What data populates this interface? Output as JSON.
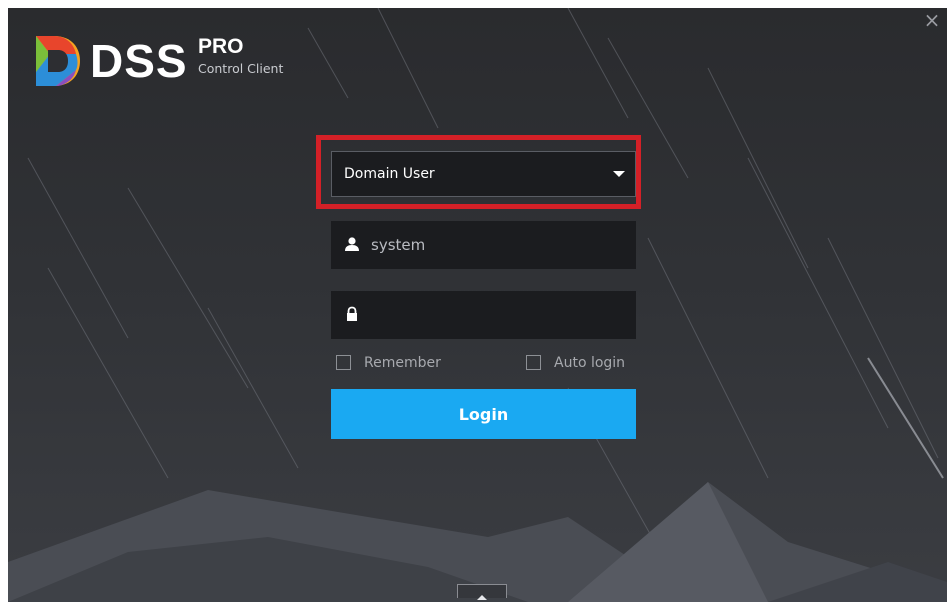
{
  "brand": {
    "name": "DSS",
    "edition": "PRO",
    "product": "Control Client"
  },
  "window": {
    "close_glyph": "×"
  },
  "login_form": {
    "user_type": "Domain User",
    "username_value": "system",
    "password_value": "",
    "remember_label": "Remember",
    "auto_login_label": "Auto login",
    "login_button_label": "Login"
  },
  "icons": {
    "user": "user-icon",
    "lock": "lock-icon",
    "dropdown": "caret-down-icon",
    "expand": "chevron-up-icon"
  },
  "colors": {
    "accent": "#1aa9f2",
    "highlight": "#d42027",
    "background": "#2f3034",
    "field_background": "#1b1c1f"
  }
}
